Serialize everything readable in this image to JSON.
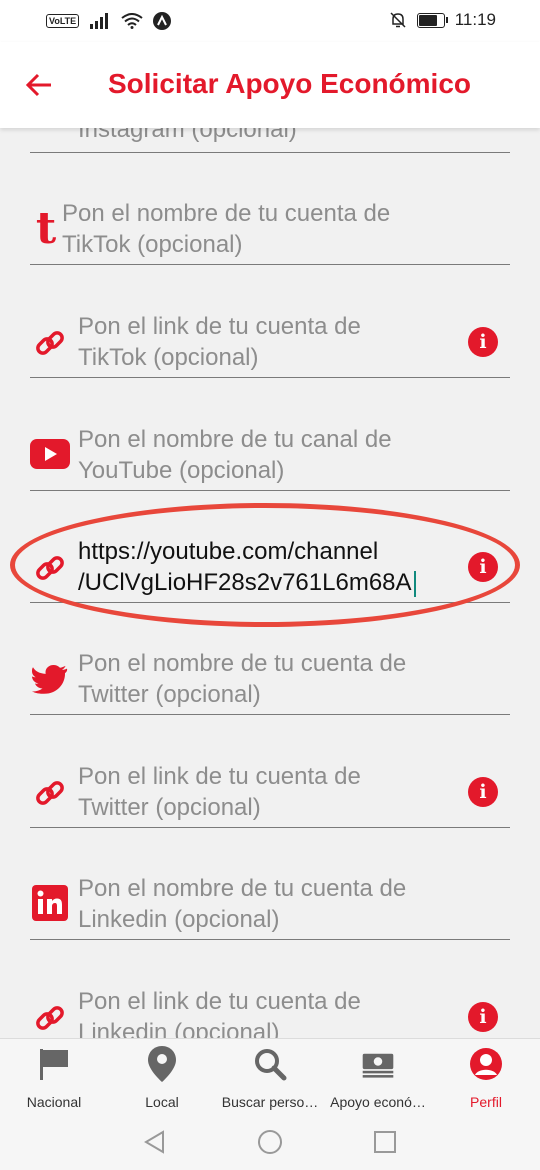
{
  "status_bar": {
    "volte": "VoLTE",
    "time": "11:19"
  },
  "appbar": {
    "title": "Solicitar Apoyo Económico",
    "back_icon": "arrow-left-icon"
  },
  "fields": [
    {
      "icon": "instagram-icon",
      "text": "Instagram (opcional)",
      "info": true
    },
    {
      "icon": "tiktok-icon",
      "text": "Pon el nombre de tu cuenta de TikTok (opcional)",
      "info": false
    },
    {
      "icon": "link-icon",
      "text": "Pon el link de tu cuenta de TikTok (opcional)",
      "info": true
    },
    {
      "icon": "youtube-icon",
      "text": "Pon el nombre de tu canal de YouTube (opcional)",
      "info": false
    },
    {
      "icon": "link-icon",
      "text": "https://youtube.com/channel/UClVgLioHF28s2v761L6m68A",
      "info": true,
      "value": true
    },
    {
      "icon": "twitter-icon",
      "text": "Pon el nombre de tu cuenta de Twitter (opcional)",
      "info": false
    },
    {
      "icon": "link-icon",
      "text": "Pon el link de tu cuenta de Twitter (opcional)",
      "info": true
    },
    {
      "icon": "linkedin-icon",
      "text": "Pon el nombre de tu cuenta de Linkedin (opcional)",
      "info": false
    },
    {
      "icon": "link-icon",
      "text": "Pon el link de tu cuenta de Linkedin (opcional)",
      "info": true
    }
  ],
  "field_texts": {
    "f0": "Instagram (opcional)",
    "f1a": "Pon el nombre de tu cuenta de",
    "f1b": "TikTok (opcional)",
    "f2a": "Pon el link de tu cuenta de",
    "f2b": "TikTok (opcional)",
    "f3a": "Pon el nombre de tu canal de",
    "f3b": "YouTube (opcional)",
    "f4a": "https://youtube.com/channel",
    "f4b": "/UClVgLioHF28s2v761L6m68A",
    "f5a": "Pon el nombre de tu cuenta de",
    "f5b": "Twitter (opcional)",
    "f6a": "Pon el link de tu cuenta de",
    "f6b": "Twitter (opcional)",
    "f7a": "Pon el nombre de tu cuenta de",
    "f7b": "Linkedin (opcional)",
    "f8a": "Pon el link de tu cuenta de",
    "f8b": "Linkedin (opcional)"
  },
  "info_glyph": "i",
  "bottom_nav": [
    {
      "label": "Nacional",
      "icon": "flag-icon",
      "active": false
    },
    {
      "label": "Local",
      "icon": "location-pin-icon",
      "active": false
    },
    {
      "label": "Buscar perso…",
      "icon": "search-icon",
      "active": false
    },
    {
      "label": "Apoyo econó…",
      "icon": "money-icon",
      "active": false
    },
    {
      "label": "Perfil",
      "icon": "profile-icon",
      "active": true
    }
  ],
  "colors": {
    "brand": "#e3192b",
    "background": "#f1f1f1",
    "annotation": "#e8473b",
    "cursor": "#118a7e"
  }
}
